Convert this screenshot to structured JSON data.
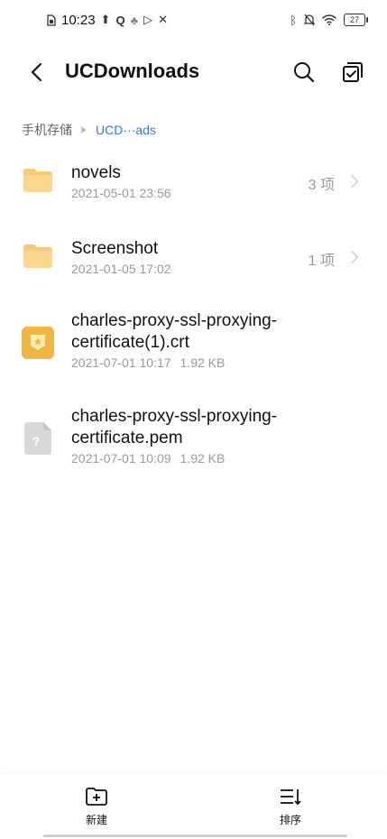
{
  "status_bar": {
    "time": "10:23",
    "battery": "27",
    "icons_left": [
      "sim-icon",
      "upload-icon",
      "q-icon",
      "app-icon",
      "play-icon",
      "tools-icon"
    ],
    "icons_right": [
      "bluetooth-icon",
      "mute-icon",
      "wifi-icon",
      "battery-icon"
    ]
  },
  "header": {
    "title": "UCDownloads",
    "icons": [
      "back-icon",
      "search-icon",
      "multi-select-icon"
    ]
  },
  "breadcrumb": {
    "root": "手机存储",
    "current": "UCD···ads"
  },
  "files": [
    {
      "name": "novels",
      "date": "2021-05-01 23:56",
      "count": "3 项",
      "type": "folder",
      "icon": "folder-icon"
    },
    {
      "name": "Screenshot",
      "date": "2021-01-05 17:02",
      "count": "1 项",
      "type": "folder",
      "icon": "folder-icon"
    },
    {
      "name": "charles-proxy-ssl-proxying-certificate(1).crt",
      "date": "2021-07-01 10:17",
      "size": "1.92 KB",
      "type": "certificate",
      "icon": "certificate-icon"
    },
    {
      "name": "charles-proxy-ssl-proxying-certificate.pem",
      "date": "2021-07-01 10:09",
      "size": "1.92 KB",
      "type": "unknown",
      "icon": "unknown-file-icon"
    }
  ],
  "bottom_bar": {
    "new_label": "新建",
    "sort_label": "排序"
  },
  "colors": {
    "folder": "#f8c978",
    "certificate": "#f0b542",
    "unknown_file": "#d8d8d8",
    "breadcrumb_active": "#3a7bd5"
  }
}
